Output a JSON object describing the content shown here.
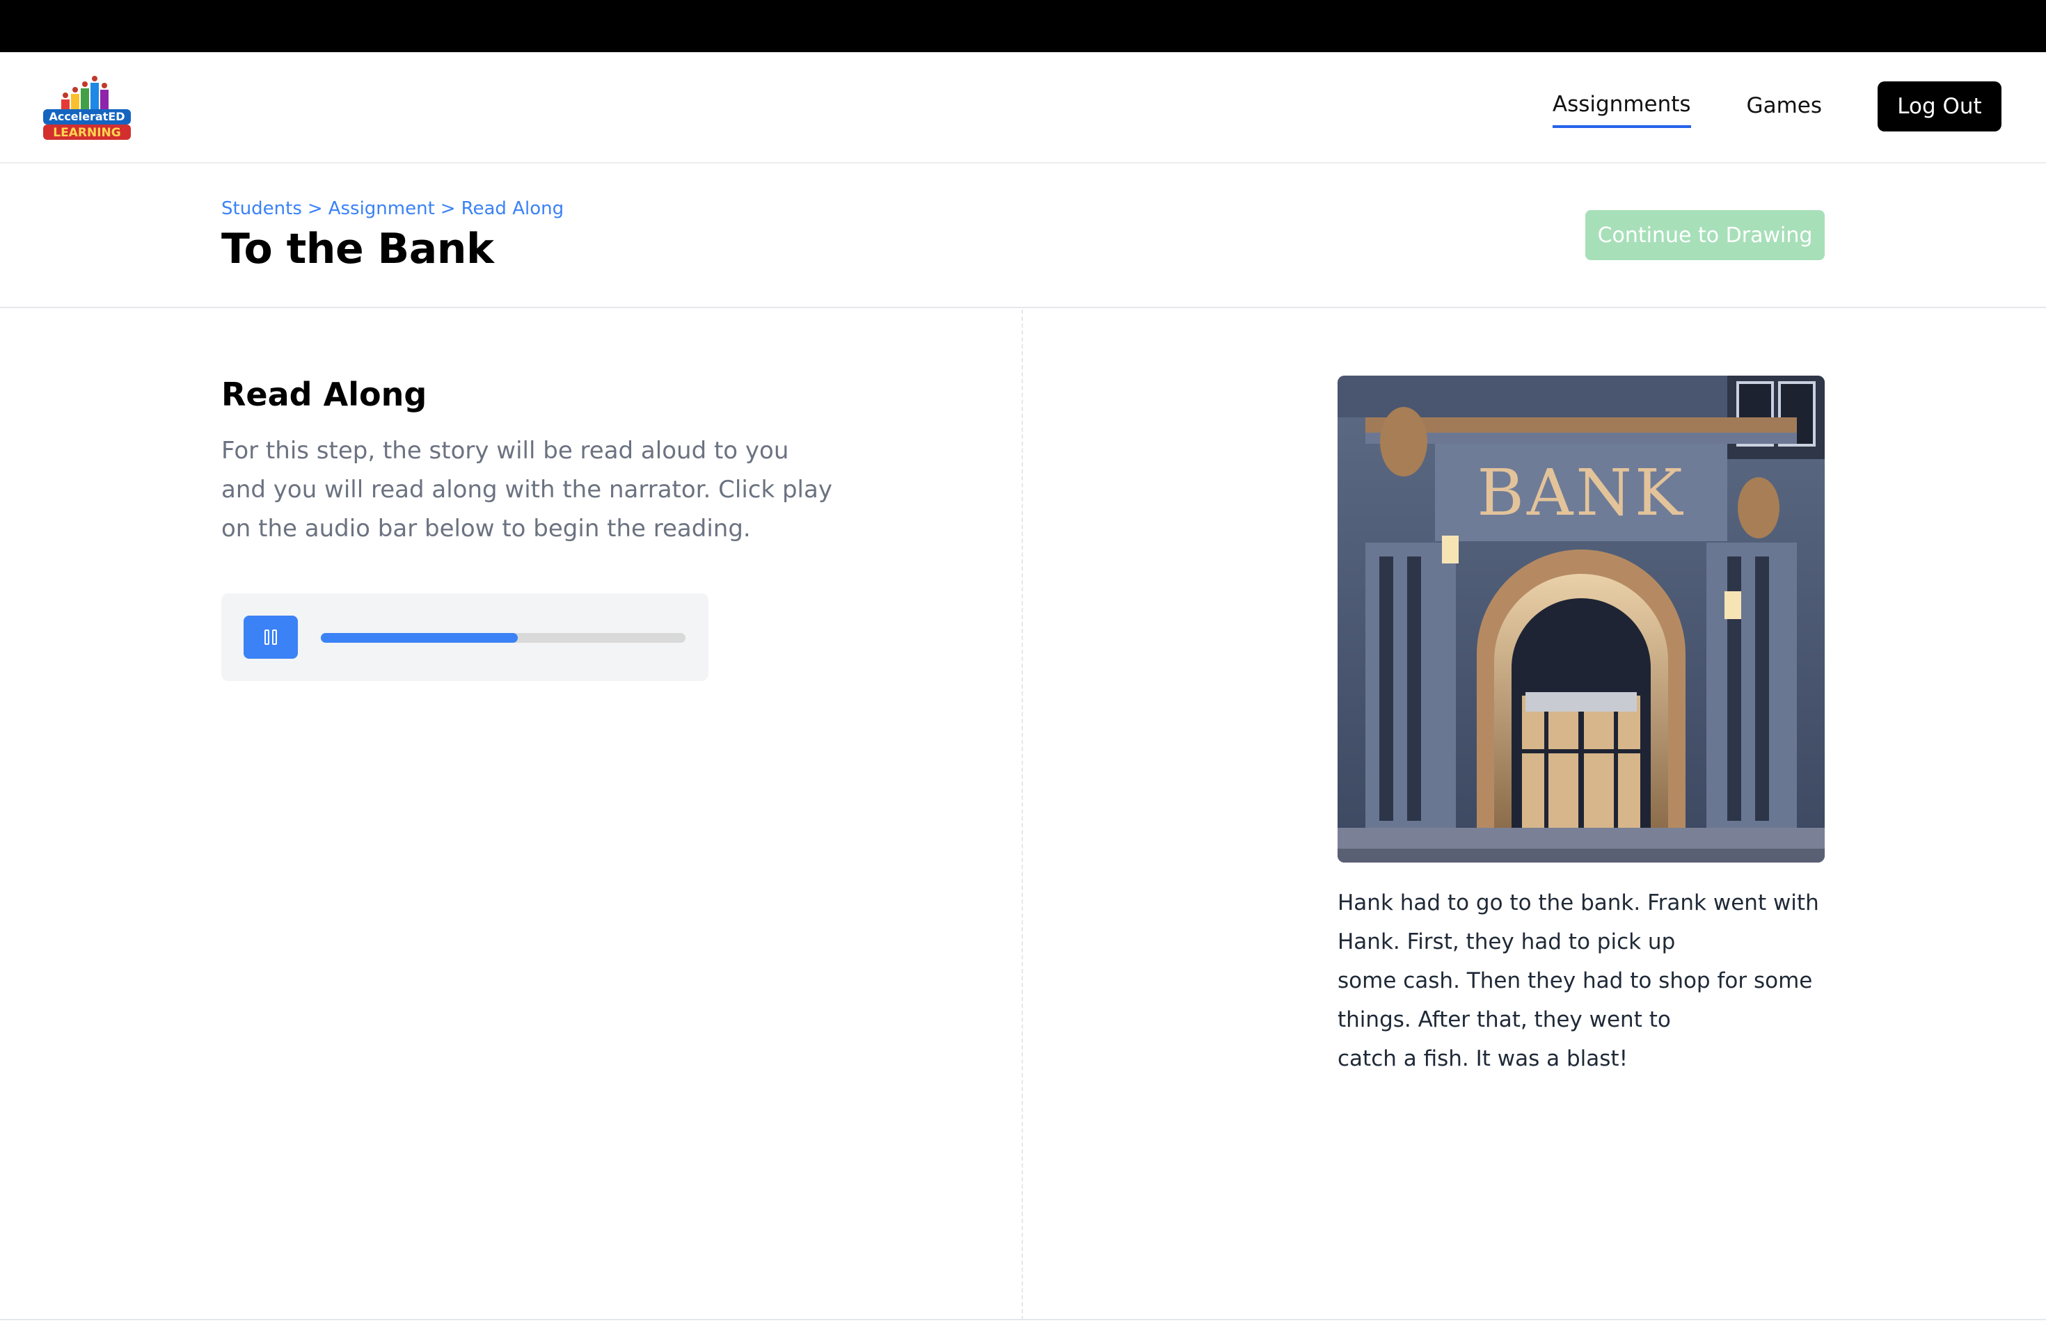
{
  "nav": {
    "logo_top": "AcceleratED",
    "logo_bottom": "LEARNING",
    "links": [
      "Assignments",
      "Games"
    ],
    "active_link": "Assignments",
    "logout_label": "Log Out"
  },
  "header": {
    "breadcrumb": [
      "Students",
      "Assignment",
      "Read Along"
    ],
    "breadcrumb_separator": ">",
    "title": "To the Bank",
    "continue_label": "Continue to Drawing",
    "continue_enabled": false
  },
  "read_along": {
    "title": "Read Along",
    "description": "For this step, the story will be read aloud to you and you will read along with the narrator. Click play on the audio bar below to begin the reading.",
    "audio": {
      "state": "playing",
      "progress_fraction": 0.54
    }
  },
  "story": {
    "image_sign_text": "BANK",
    "lines": [
      "Hank had to go to the bank. Frank went with Hank. First, they had to pick up",
      "some cash. Then they had to shop for some things. After that, they went to",
      "catch a fish. It was a blast!"
    ]
  },
  "colors": {
    "accent": "#3b82f6",
    "continue_disabled": "#a7dfb9",
    "topbar": "#000000"
  }
}
